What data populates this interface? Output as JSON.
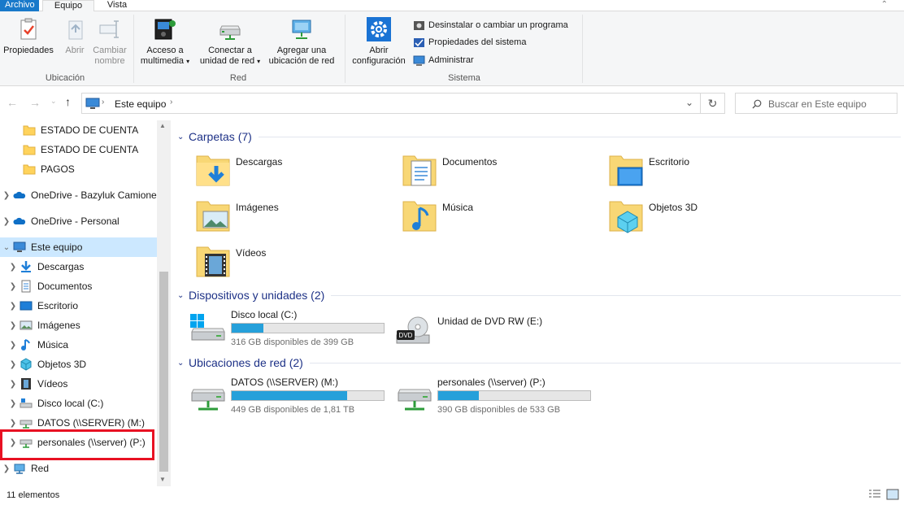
{
  "tabs": {
    "file": "Archivo",
    "computer": "Equipo",
    "view": "Vista"
  },
  "ribbon": {
    "ubicacion": {
      "label": "Ubicación",
      "properties": "Propiedades",
      "open": "Abrir",
      "rename_line1": "Cambiar",
      "rename_line2": "nombre"
    },
    "red": {
      "label": "Red",
      "media_line1": "Acceso a",
      "media_line2": "multimedia",
      "map_line1": "Conectar a",
      "map_line2": "unidad de red",
      "addnet_line1": "Agregar una",
      "addnet_line2": "ubicación de red"
    },
    "sistema": {
      "label": "Sistema",
      "settings_line1": "Abrir",
      "settings_line2": "configuración",
      "uninstall": "Desinstalar o cambiar un programa",
      "sysprops": "Propiedades del sistema",
      "manage": "Administrar"
    }
  },
  "address": {
    "path": "Este equipo"
  },
  "search": {
    "placeholder": "Buscar en Este equipo"
  },
  "navpane": {
    "items": [
      {
        "label": "ESTADO DE CUENTA"
      },
      {
        "label": "ESTADO DE CUENTA"
      },
      {
        "label": "PAGOS"
      },
      {
        "label": "OneDrive - Bazyluk Camiones"
      },
      {
        "label": "OneDrive - Personal"
      },
      {
        "label": "Este equipo"
      },
      {
        "label": "Descargas"
      },
      {
        "label": "Documentos"
      },
      {
        "label": "Escritorio"
      },
      {
        "label": "Imágenes"
      },
      {
        "label": "Música"
      },
      {
        "label": "Objetos 3D"
      },
      {
        "label": "Vídeos"
      },
      {
        "label": "Disco local (C:)"
      },
      {
        "label": "DATOS (\\\\SERVER) (M:)"
      },
      {
        "label": "personales (\\\\server) (P:)"
      },
      {
        "label": "Red"
      }
    ]
  },
  "sections": {
    "folders": "Carpetas (7)",
    "devices": "Dispositivos y unidades (2)",
    "network": "Ubicaciones de red (2)"
  },
  "folders": [
    {
      "name": "Descargas",
      "icon": "download-folder-icon"
    },
    {
      "name": "Documentos",
      "icon": "documents-folder-icon"
    },
    {
      "name": "Escritorio",
      "icon": "desktop-folder-icon"
    },
    {
      "name": "Imágenes",
      "icon": "pictures-folder-icon"
    },
    {
      "name": "Música",
      "icon": "music-folder-icon"
    },
    {
      "name": "Objetos 3D",
      "icon": "3d-objects-folder-icon"
    },
    {
      "name": "Vídeos",
      "icon": "videos-folder-icon"
    }
  ],
  "devices": [
    {
      "name": "Disco local (C:)",
      "free": "316 GB disponibles de 399 GB",
      "used_fraction": 0.21
    },
    {
      "name": "Unidad de DVD RW (E:)",
      "dvd_label": "DVD"
    }
  ],
  "network": [
    {
      "name": "DATOS (\\\\SERVER) (M:)",
      "free": "449 GB disponibles de 1,81 TB",
      "used_fraction": 0.76
    },
    {
      "name": "personales (\\\\server) (P:)",
      "free": "390 GB disponibles de 533 GB",
      "used_fraction": 0.27
    }
  ],
  "status": {
    "count": "11 elementos"
  },
  "colors": {
    "accent": "#1979ca",
    "bar_fill": "#26a0da",
    "selection": "#cce8ff",
    "highlight": "#e81123",
    "section_title": "#1e3287"
  }
}
